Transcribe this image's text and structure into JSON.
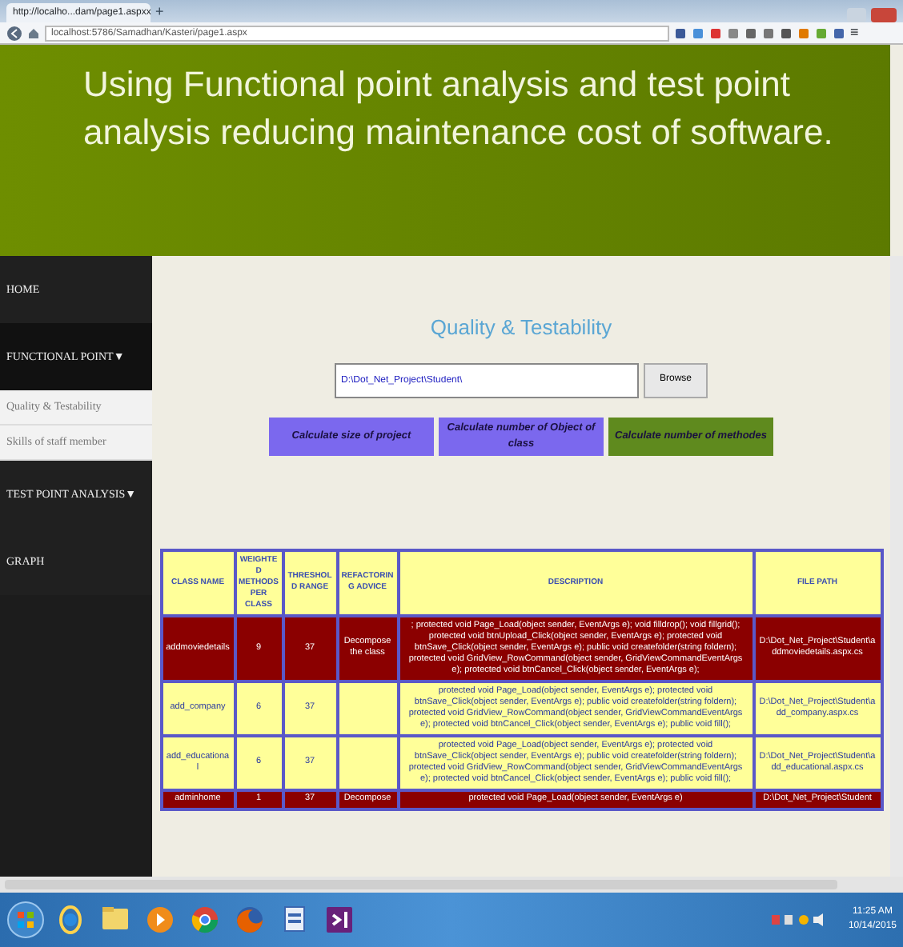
{
  "browser": {
    "tab_title": "http://localho...dam/page1.aspx",
    "tab_close": "x",
    "new_tab": "+",
    "address": "localhost:5786/Samadhan/Kasteri/page1.aspx",
    "menu": "≡"
  },
  "header": {
    "title": "Using Functional point analysis and test point analysis reducing maintenance cost of software."
  },
  "sidebar": {
    "items": [
      {
        "label": "HOME"
      },
      {
        "label": "FUNCTIONAL POINT",
        "caret": "▼",
        "expanded": true,
        "children": [
          {
            "label": "Quality & Testability"
          },
          {
            "label": "Skills of staff member"
          }
        ]
      },
      {
        "label": "TEST POINT ANALYSIS",
        "caret": "▼",
        "expanded": false
      },
      {
        "label": "GRAPH"
      }
    ]
  },
  "content": {
    "title": "Quality & Testability",
    "path_field": {
      "value": "D:\\Dot_Net_Project\\Student\\"
    },
    "browse_button": "Browse",
    "actions": [
      {
        "label": "Calculate size of project",
        "color": "#7b68ee"
      },
      {
        "label": "Calculate number of Object of class",
        "color": "#7b68ee"
      },
      {
        "label": "Calculate number of methodes",
        "color": "#5f8a1e"
      }
    ]
  },
  "table": {
    "columns": [
      "CLASS NAME",
      "WEIGHTED METHODS PER CLASS",
      "THRESHOLD RANGE",
      "REFACTORING ADVICE",
      "DESCRIPTION",
      "FILE PATH"
    ],
    "rows": [
      {
        "highlighted": true,
        "cells": [
          "addmoviedetails",
          "9",
          "37",
          "Decompose the class",
          "; protected void Page_Load(object sender, EventArgs e); void filldrop(); void fillgrid(); protected void btnUpload_Click(object sender, EventArgs e); protected void btnSave_Click(object sender, EventArgs e); public void createfolder(string foldern); protected void GridView_RowCommand(object sender, GridViewCommandEventArgs e); protected void btnCancel_Click(object sender, EventArgs e);",
          "D:\\Dot_Net_Project\\Student\\addmoviedetails.aspx.cs"
        ]
      },
      {
        "highlighted": false,
        "cells": [
          "add_company",
          "6",
          "37",
          "",
          "protected void Page_Load(object sender, EventArgs e); protected void btnSave_Click(object sender, EventArgs e); public void createfolder(string foldern); protected void GridView_RowCommand(object sender, GridViewCommandEventArgs e); protected void btnCancel_Click(object sender, EventArgs e); public void fill();",
          "D:\\Dot_Net_Project\\Student\\add_company.aspx.cs"
        ]
      },
      {
        "highlighted": false,
        "cells": [
          "add_educational",
          "6",
          "37",
          "",
          "protected void Page_Load(object sender, EventArgs e); protected void btnSave_Click(object sender, EventArgs e); public void createfolder(string foldern); protected void GridView_RowCommand(object sender, GridViewCommandEventArgs e); protected void btnCancel_Click(object sender, EventArgs e); public void fill();",
          "D:\\Dot_Net_Project\\Student\\add_educational.aspx.cs"
        ]
      },
      {
        "highlighted": true,
        "cells": [
          "adminhome",
          "1",
          "37",
          "Decompose",
          "protected void Page_Load(object sender, EventArgs e)",
          "D:\\Dot_Net_Project\\Student"
        ]
      }
    ]
  },
  "taskbar": {
    "time": "11:25 AM",
    "date": "10/14/2015"
  }
}
